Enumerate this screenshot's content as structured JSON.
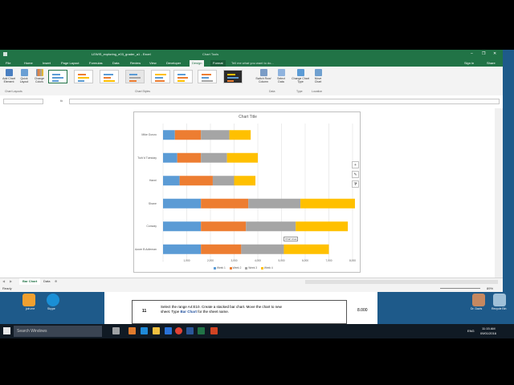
{
  "window": {
    "title": "LEWIS_exploring_e03_grader_a1 - Excel",
    "chart_tools": "Chart Tools",
    "tabs": [
      "File",
      "Home",
      "Insert",
      "Page Layout",
      "Formulas",
      "Data",
      "Review",
      "View",
      "Developer",
      "Design",
      "Format"
    ],
    "active_tab": "Design",
    "tell_me": "Tell me what you want to do...",
    "sign_in": "Sign in",
    "share": "Share"
  },
  "ribbon": {
    "add_chart_element": "Add Chart Element",
    "quick_layout": "Quick Layout",
    "change_colors": "Change Colors",
    "switch_row_column": "Switch Row/ Column",
    "select_data": "Select Data",
    "change_chart_type": "Change Chart Type",
    "move_chart": "Move Chart",
    "groups": {
      "chart_layouts": "Chart Layouts",
      "chart_styles": "Chart Styles",
      "data": "Data",
      "type": "Type",
      "location": "Location"
    }
  },
  "formula_bar": {
    "fx": "fx"
  },
  "sheet_tabs": [
    "Bar Chart",
    "Data"
  ],
  "active_sheet": "Bar Chart",
  "status": {
    "ready": "Ready",
    "zoom": "89%"
  },
  "tooltip": "Chart Area",
  "document": {
    "step_number": "11",
    "step_text_1": "Select the range A4:E10. Create a stacked bar chart. Move the chart to new sheet. Type",
    "step_highlight": "Bar Chart",
    "step_text_2": "for the sheet name.",
    "points": "8.000"
  },
  "taskbar": {
    "search_placeholder": "Search Windows",
    "time": "11:15 AM",
    "date": "09/01/2016",
    "lang": "ENG"
  },
  "desktop": {
    "left_labels": [
      "join.me",
      "Skype"
    ],
    "right_labels": [
      "Dr. Davis",
      "Recycle Bin"
    ]
  },
  "colors": {
    "excel_green": "#217346",
    "week1": "#5b9bd5",
    "week2": "#ed7d31",
    "week3": "#a5a5a5",
    "week4": "#ffc000"
  },
  "chart_data": {
    "type": "bar",
    "stacked": true,
    "title": "Chart Title",
    "categories": [
      "Mike Gonzo",
      "Turk'd Tuesday",
      "Hanni",
      "Shane",
      "Conway",
      "Azure B Adleman"
    ],
    "series": [
      {
        "name": "Week 1",
        "values": [
          500,
          600,
          700,
          1600,
          1600,
          1600
        ]
      },
      {
        "name": "Week 2",
        "values": [
          1100,
          1000,
          1400,
          2000,
          1900,
          1700
        ]
      },
      {
        "name": "Week 3",
        "values": [
          1200,
          1100,
          900,
          2200,
          2100,
          1800
        ]
      },
      {
        "name": "Week 4",
        "values": [
          900,
          1300,
          900,
          2300,
          2200,
          1900
        ]
      }
    ],
    "xticks": [
      "-",
      "1,000",
      "2,000",
      "3,000",
      "4,000",
      "5,000",
      "6,000",
      "7,000",
      "8,000"
    ],
    "xlim": [
      0,
      8000
    ],
    "legend": "bottom",
    "grid": true
  }
}
